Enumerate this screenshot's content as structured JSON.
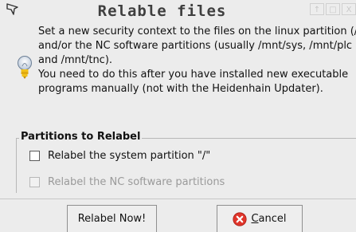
{
  "window": {
    "title": "Relable files",
    "controls": {
      "up": "↑",
      "maximize": "□",
      "close": "X"
    }
  },
  "info": {
    "lines": [
      "Set a new security context to the files on the linux partition (/",
      "and/or the NC software partitions (usually /mnt/sys, /mnt/plc",
      "and /mnt/tnc).",
      "You need to do this after you have installed new executable",
      "programs manually (not with the Heidenhain Updater)."
    ]
  },
  "partitions": {
    "title": "Partitions to Relabel",
    "options": [
      {
        "label": "Relabel the system partition \"/\"",
        "checked": false,
        "enabled": true
      },
      {
        "label": "Relabel the NC software partitions",
        "checked": false,
        "enabled": false
      }
    ]
  },
  "buttons": {
    "relabel_label": "Relabel Now!",
    "cancel_mnemonic": "C",
    "cancel_rest": "ancel"
  },
  "colors": {
    "background": "#ececec",
    "cancel_icon": "#e0352b"
  }
}
